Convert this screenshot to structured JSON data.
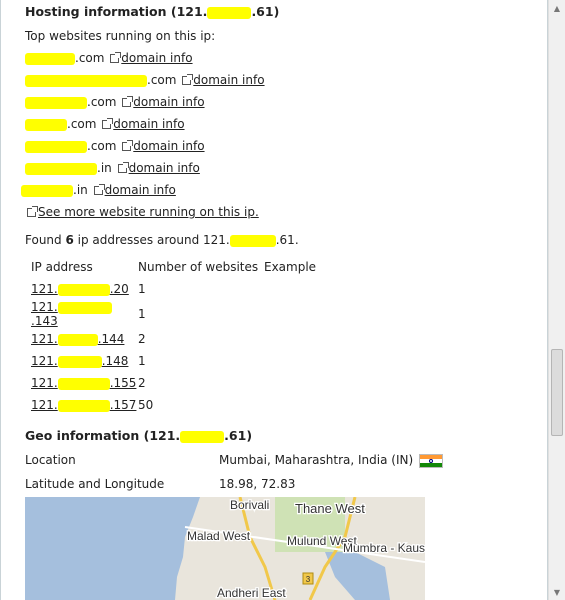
{
  "hosting": {
    "title": "Hosting information (121.",
    "title_suffix": ".61)",
    "top_label": "Top websites running on this ip:",
    "sites": [
      {
        "tld": ".com",
        "link": "domain info"
      },
      {
        "tld": ".com",
        "link": "domain info"
      },
      {
        "tld": ".com",
        "link": "domain info"
      },
      {
        "tld": ".com",
        "link": "domain info"
      },
      {
        "tld": ".com",
        "link": "domain info"
      },
      {
        "tld": ".in",
        "link": "domain info"
      },
      {
        "tld": ".in",
        "link": "domain info"
      }
    ],
    "see_more": "See more website running on this ip.",
    "found_prefix": "Found ",
    "found_count": "6",
    "found_mid": " ip addresses around 121.",
    "found_suffix": ".61.",
    "table": {
      "headers": [
        "IP address",
        "Number of websites",
        "Example"
      ],
      "rows": [
        {
          "ip_start": "121.",
          "ip_end": ".20",
          "count": "1"
        },
        {
          "ip_start": "121.",
          "ip_end": ".143",
          "count": "1"
        },
        {
          "ip_start": "121.",
          "ip_end": ".144",
          "count": "2"
        },
        {
          "ip_start": "121.",
          "ip_end": ".148",
          "count": "1"
        },
        {
          "ip_start": "121.",
          "ip_end": ".155",
          "count": "2"
        },
        {
          "ip_start": "121.",
          "ip_end": ".157",
          "count": "50"
        }
      ]
    }
  },
  "geo": {
    "title": "Geo information (121.",
    "title_suffix": ".61)",
    "location_label": "Location",
    "location_value": "Mumbai, Maharashtra, India (IN)",
    "latlon_label": "Latitude and Longitude",
    "latlon_value": "18.98, 72.83",
    "map_labels": [
      "Borivali",
      "Thane West",
      "Malad West",
      "Mulund West",
      "Mumbra - Kausa",
      "Andheri East"
    ],
    "map_road_number": "3"
  },
  "colors": {
    "highlight": "#ffff00",
    "water": "#a5bfdd",
    "land": "#e9e5dc"
  }
}
